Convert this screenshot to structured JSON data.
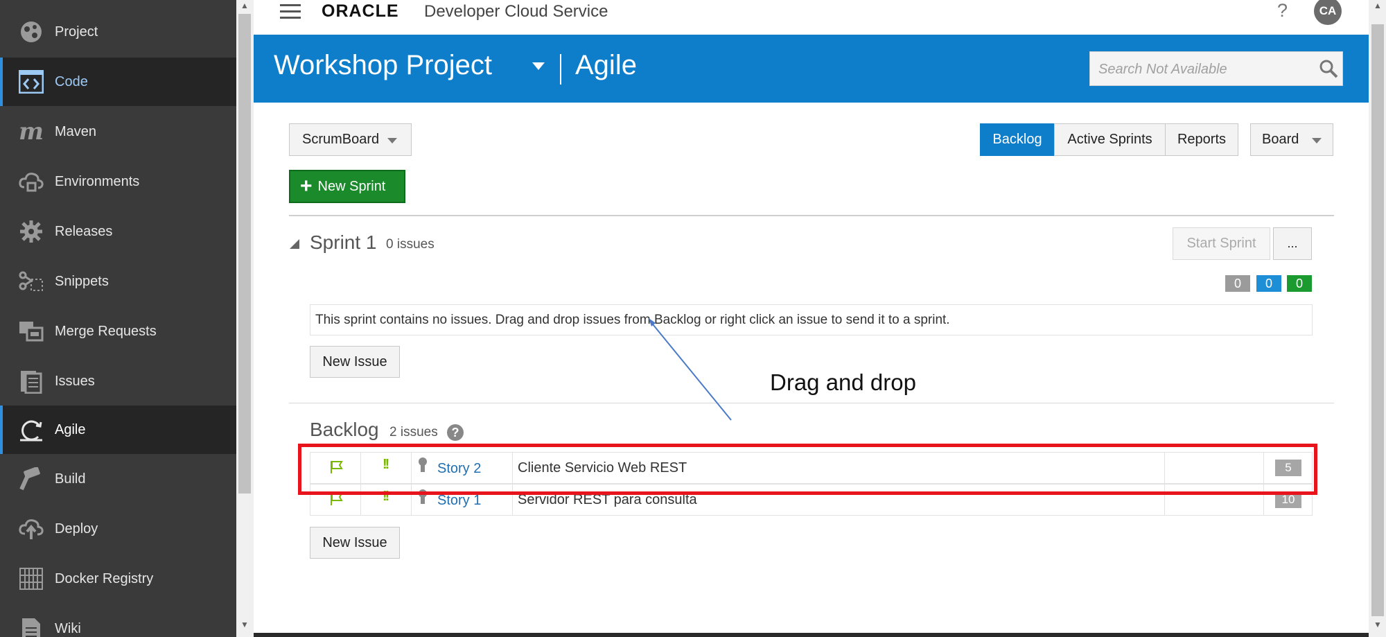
{
  "sidebar": {
    "items": [
      {
        "label": "Project",
        "icon": "project-icon"
      },
      {
        "label": "Code",
        "icon": "code-icon"
      },
      {
        "label": "Maven",
        "icon": "maven-icon"
      },
      {
        "label": "Environments",
        "icon": "environments-icon"
      },
      {
        "label": "Releases",
        "icon": "releases-icon"
      },
      {
        "label": "Snippets",
        "icon": "snippets-icon"
      },
      {
        "label": "Merge Requests",
        "icon": "merge-requests-icon"
      },
      {
        "label": "Issues",
        "icon": "issues-icon"
      },
      {
        "label": "Agile",
        "icon": "agile-icon"
      },
      {
        "label": "Build",
        "icon": "build-icon"
      },
      {
        "label": "Deploy",
        "icon": "deploy-icon"
      },
      {
        "label": "Docker Registry",
        "icon": "docker-registry-icon"
      },
      {
        "label": "Wiki",
        "icon": "wiki-icon"
      }
    ],
    "active_items": [
      "Code",
      "Agile"
    ]
  },
  "header": {
    "logo": "ORACLE",
    "service_name": "Developer Cloud Service",
    "help": "?",
    "avatar_initials": "CA"
  },
  "banner": {
    "project_name": "Workshop Project",
    "section": "Agile",
    "search_placeholder": "Search Not Available"
  },
  "toolbar": {
    "board_selector": "ScrumBoard",
    "new_sprint": "New Sprint",
    "views": [
      "Backlog",
      "Active Sprints",
      "Reports"
    ],
    "active_view": "Backlog",
    "board_menu": "Board"
  },
  "sprint": {
    "name": "Sprint 1",
    "issue_count": "0 issues",
    "start_button": "Start Sprint",
    "more_button": "...",
    "badges": [
      "0",
      "0",
      "0"
    ],
    "empty_message": "This sprint contains no issues. Drag and drop issues from Backlog or right click an issue to send it to a sprint.",
    "new_issue": "New Issue"
  },
  "backlog": {
    "title": "Backlog",
    "issue_count": "2 issues",
    "help": "?",
    "issues": [
      {
        "key": "Story 2",
        "summary": "Cliente Servicio Web REST",
        "points": "5"
      },
      {
        "key": "Story 1",
        "summary": "Servidor REST para consulta",
        "points": "10"
      }
    ],
    "new_issue": "New Issue"
  },
  "annotation": {
    "label": "Drag and drop"
  },
  "colors": {
    "brand_blue": "#0e7dca",
    "new_sprint_green": "#1a8a2a",
    "highlight_red": "#e8141b",
    "sidebar_bg": "#3a3a3a"
  }
}
